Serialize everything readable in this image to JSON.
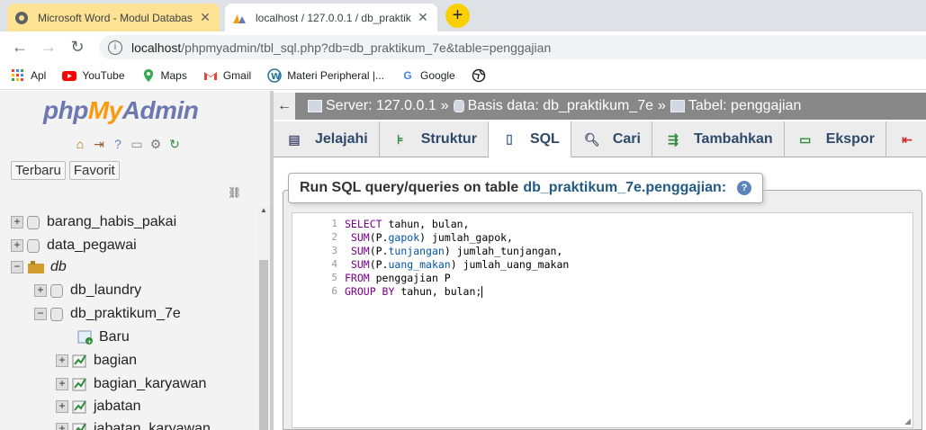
{
  "browser": {
    "tabs": [
      {
        "title": "Microsoft Word - Modul Databas",
        "close": "✕"
      },
      {
        "title": "localhost / 127.0.0.1 / db_praktik",
        "close": "✕"
      }
    ],
    "new_tab": "+",
    "url_host": "localhost",
    "url_path": "/phpmyadmin/tbl_sql.php?db=db_praktikum_7e&table=penggajian",
    "bookmarks": [
      "Apl",
      "YouTube",
      "Maps",
      "Gmail",
      "Materi Peripheral |...",
      "Google"
    ]
  },
  "sidebar": {
    "logo": {
      "php": "php",
      "my": "My",
      "admin": "Admin"
    },
    "tabs": [
      "Terbaru",
      "Favorit"
    ],
    "tree": [
      {
        "label": "barang_habis_pakai",
        "kind": "db"
      },
      {
        "label": "data_pegawai",
        "kind": "db"
      },
      {
        "label": "db",
        "kind": "group"
      },
      {
        "label": "db_laundry",
        "kind": "db"
      },
      {
        "label": "db_praktikum_7e",
        "kind": "db"
      },
      {
        "label": "Baru",
        "kind": "new"
      },
      {
        "label": "bagian",
        "kind": "table"
      },
      {
        "label": "bagian_karyawan",
        "kind": "table"
      },
      {
        "label": "jabatan",
        "kind": "table"
      },
      {
        "label": "jabatan_karyawan",
        "kind": "table"
      }
    ]
  },
  "breadcrumb": {
    "server": "Server: 127.0.0.1",
    "database": "Basis data: db_praktikum_7e",
    "table": "Tabel: penggajian",
    "sep": "»"
  },
  "menu": [
    "Jelajahi",
    "Struktur",
    "SQL",
    "Cari",
    "Tambahkan",
    "Ekspor"
  ],
  "active_menu": "SQL",
  "query": {
    "legend": "Run SQL query/queries on table",
    "table": "db_praktikum_7e.penggajian:",
    "help": "?",
    "line_numbers": [
      "1",
      "2",
      "3",
      "4",
      "5",
      "6"
    ]
  },
  "colors": {
    "pma_blue": "#6c78af",
    "pma_orange": "#f89c0e",
    "link": "#235a81"
  }
}
